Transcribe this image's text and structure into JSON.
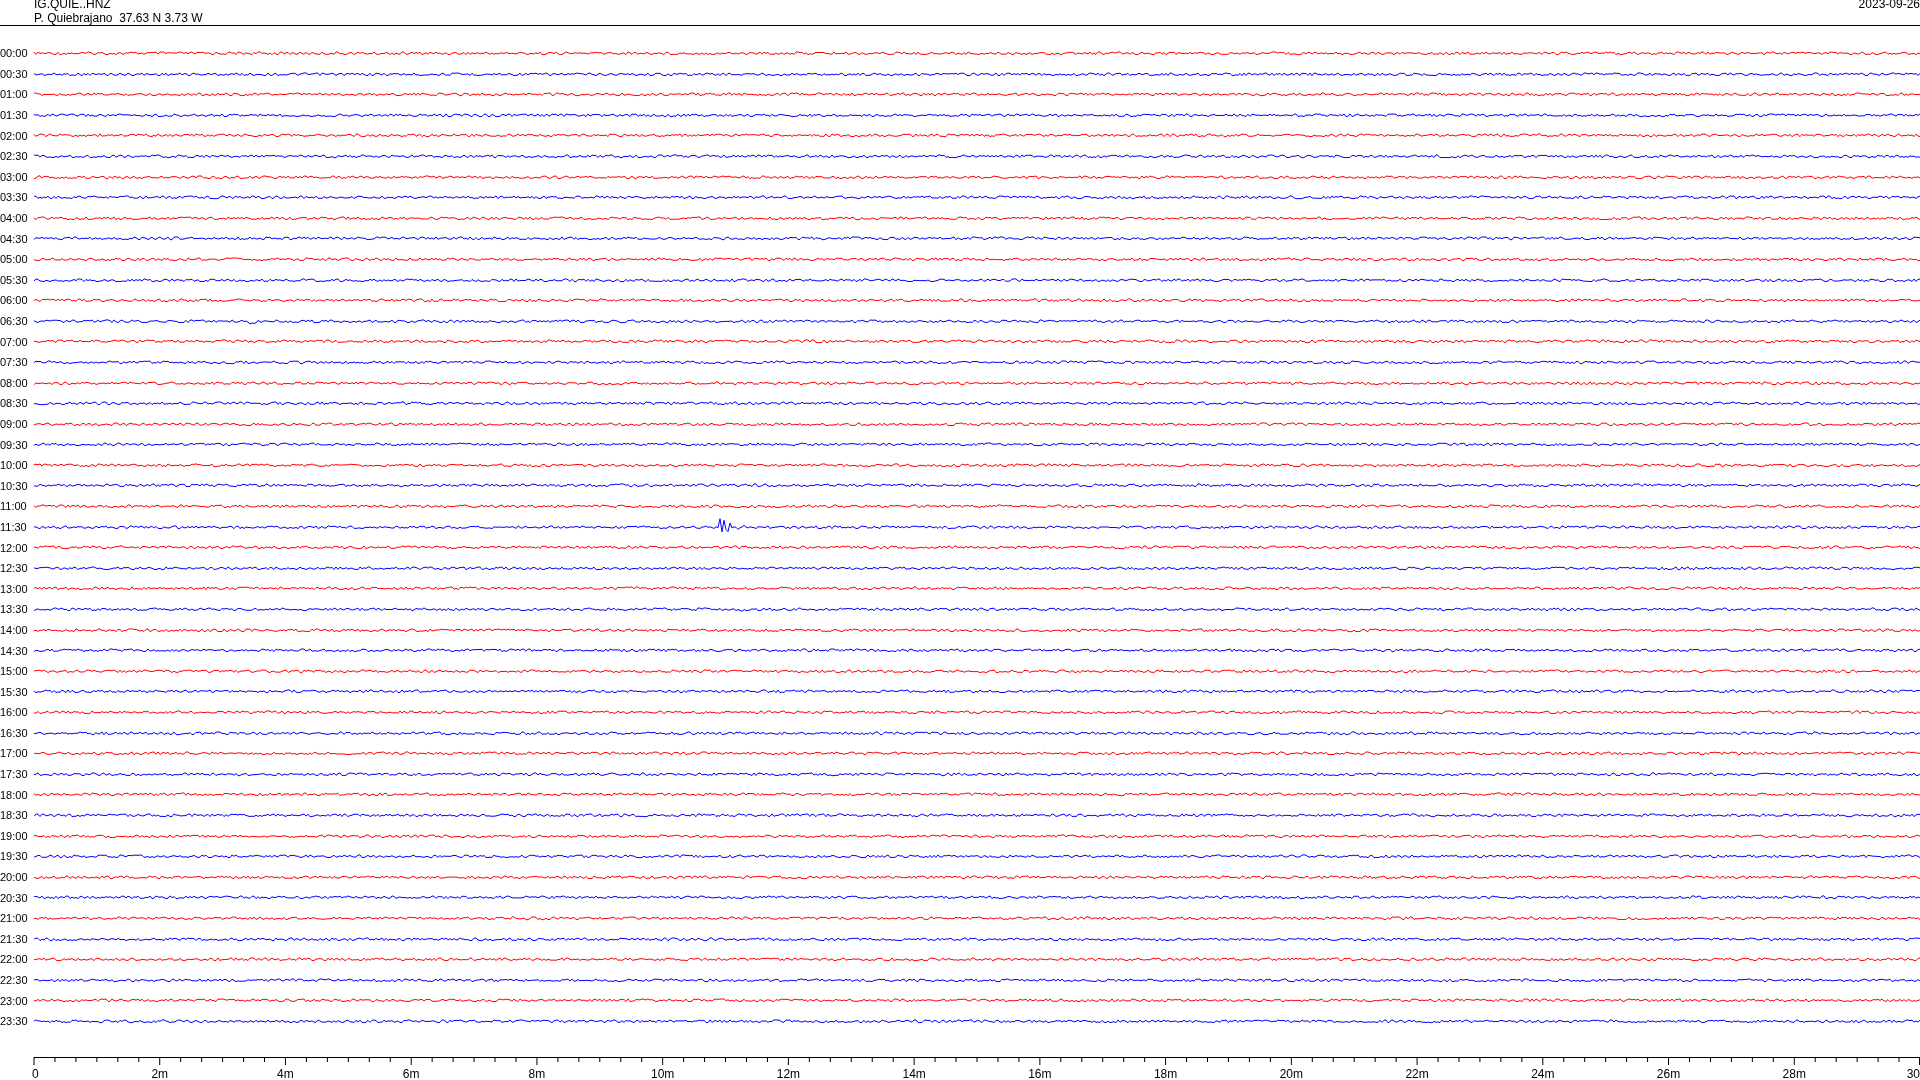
{
  "header": {
    "station": "IG.QUIE..HNZ",
    "location": "P. Quiebrajano  37.63 N 3.73 W",
    "date": "2023-09-26"
  },
  "rows": [
    {
      "time": "00:00",
      "color": "#ff0000"
    },
    {
      "time": "00:30",
      "color": "#0000ff"
    },
    {
      "time": "01:00",
      "color": "#ff0000"
    },
    {
      "time": "01:30",
      "color": "#0000ff"
    },
    {
      "time": "02:00",
      "color": "#ff0000"
    },
    {
      "time": "02:30",
      "color": "#0000ff"
    },
    {
      "time": "03:00",
      "color": "#ff0000"
    },
    {
      "time": "03:30",
      "color": "#0000ff"
    },
    {
      "time": "04:00",
      "color": "#ff0000"
    },
    {
      "time": "04:30",
      "color": "#0000ff"
    },
    {
      "time": "05:00",
      "color": "#ff0000"
    },
    {
      "time": "05:30",
      "color": "#0000ff"
    },
    {
      "time": "06:00",
      "color": "#ff0000"
    },
    {
      "time": "06:30",
      "color": "#0000ff"
    },
    {
      "time": "07:00",
      "color": "#ff0000"
    },
    {
      "time": "07:30",
      "color": "#0000ff"
    },
    {
      "time": "08:00",
      "color": "#ff0000"
    },
    {
      "time": "08:30",
      "color": "#0000ff"
    },
    {
      "time": "09:00",
      "color": "#ff0000"
    },
    {
      "time": "09:30",
      "color": "#0000ff"
    },
    {
      "time": "10:00",
      "color": "#ff0000"
    },
    {
      "time": "10:30",
      "color": "#0000ff"
    },
    {
      "time": "11:00",
      "color": "#ff0000"
    },
    {
      "time": "11:30",
      "color": "#0000ff"
    },
    {
      "time": "12:00",
      "color": "#ff0000"
    },
    {
      "time": "12:30",
      "color": "#0000ff"
    },
    {
      "time": "13:00",
      "color": "#ff0000"
    },
    {
      "time": "13:30",
      "color": "#0000ff"
    },
    {
      "time": "14:00",
      "color": "#ff0000"
    },
    {
      "time": "14:30",
      "color": "#0000ff"
    },
    {
      "time": "15:00",
      "color": "#ff0000"
    },
    {
      "time": "15:30",
      "color": "#0000ff"
    },
    {
      "time": "16:00",
      "color": "#ff0000"
    },
    {
      "time": "16:30",
      "color": "#0000ff"
    },
    {
      "time": "17:00",
      "color": "#ff0000"
    },
    {
      "time": "17:30",
      "color": "#0000ff"
    },
    {
      "time": "18:00",
      "color": "#ff0000"
    },
    {
      "time": "18:30",
      "color": "#0000ff"
    },
    {
      "time": "19:00",
      "color": "#ff0000"
    },
    {
      "time": "19:30",
      "color": "#0000ff"
    },
    {
      "time": "20:00",
      "color": "#ff0000"
    },
    {
      "time": "20:30",
      "color": "#0000ff"
    },
    {
      "time": "21:00",
      "color": "#ff0000"
    },
    {
      "time": "21:30",
      "color": "#0000ff"
    },
    {
      "time": "22:00",
      "color": "#ff0000"
    },
    {
      "time": "22:30",
      "color": "#0000ff"
    },
    {
      "time": "23:00",
      "color": "#ff0000"
    },
    {
      "time": "23:30",
      "color": "#0000ff"
    }
  ],
  "x_axis": {
    "labels": [
      "0",
      "2m",
      "4m",
      "6m",
      "8m",
      "10m",
      "12m",
      "14m",
      "16m",
      "18m",
      "20m",
      "22m",
      "24m",
      "26m",
      "28m",
      "30"
    ]
  }
}
